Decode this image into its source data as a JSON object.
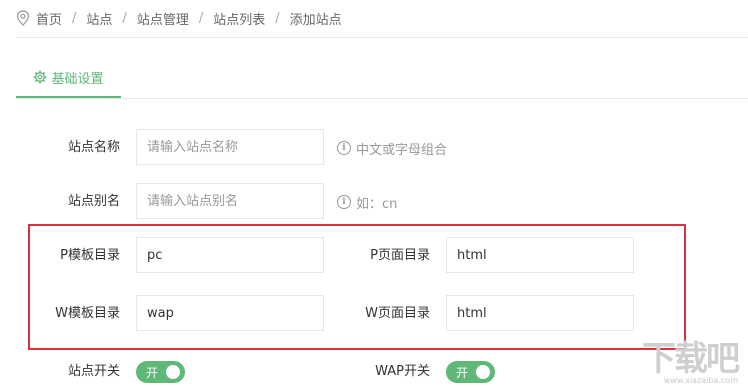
{
  "breadcrumb": {
    "items": [
      "首页",
      "站点",
      "站点管理",
      "站点列表",
      "添加站点"
    ],
    "separator": "/"
  },
  "tab": {
    "label": "基础设置"
  },
  "form": {
    "site_name": {
      "label": "站点名称",
      "placeholder": "请输入站点名称",
      "hint": "中文或字母组合"
    },
    "site_alias": {
      "label": "站点别名",
      "placeholder": "请输入站点别名",
      "hint": "如：cn"
    },
    "p_template": {
      "label": "P模板目录",
      "value": "pc"
    },
    "p_page": {
      "label": "P页面目录",
      "value": "html"
    },
    "w_template": {
      "label": "W模板目录",
      "value": "wap"
    },
    "w_page": {
      "label": "W页面目录",
      "value": "html"
    },
    "site_switch": {
      "label": "站点开关",
      "state": "开",
      "on": true
    },
    "wap_switch": {
      "label": "WAP开关",
      "state": "开",
      "on": true
    }
  },
  "watermark": {
    "big": "下载吧",
    "small": "www.xiazaiba.com"
  },
  "colors": {
    "accent": "#5fb878",
    "highlight": "#d8323e",
    "border": "#e6e6e6"
  }
}
